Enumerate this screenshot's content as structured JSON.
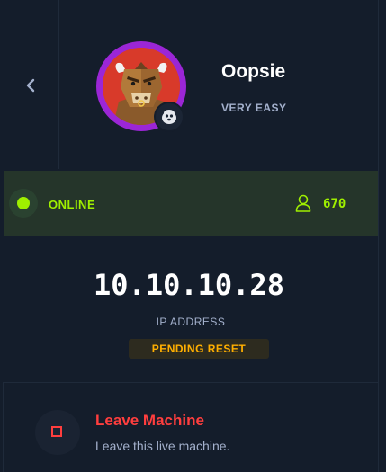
{
  "machine": {
    "name": "Oopsie",
    "difficulty": "VERY EASY",
    "avatar_icon": "bull-mascot-icon",
    "os_icon": "linux-penguin-icon",
    "ring_color": "#9b26d6"
  },
  "status": {
    "state": "ONLINE",
    "players": "670",
    "accent": "#9fef00"
  },
  "ip": {
    "value": "10.10.10.28",
    "label": "IP ADDRESS",
    "badge": "PENDING RESET"
  },
  "leave": {
    "title": "Leave Machine",
    "description": "Leave this live machine.",
    "accent": "#ff3e3e"
  }
}
